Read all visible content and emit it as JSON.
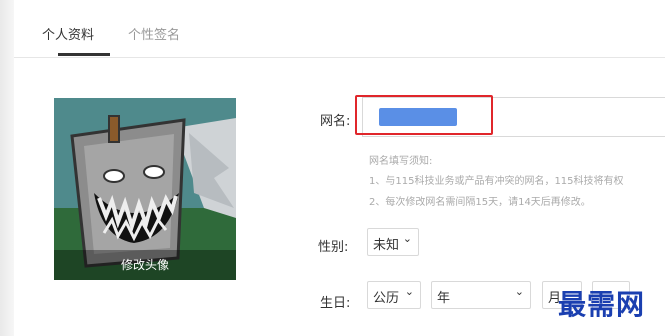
{
  "tabs": [
    {
      "label": "个人资料",
      "active": true
    },
    {
      "label": "个性签名",
      "active": false
    }
  ],
  "avatar": {
    "caption": "修改头像"
  },
  "form": {
    "nickname_label": "网名:",
    "nickname_value": "",
    "notice": [
      "网名填写须知:",
      "1、与115科技业务或产品有冲突的网名，115科技将有权",
      "2、每次修改网名需间隔15天，请14天后再修改。"
    ],
    "gender_label": "性别:",
    "gender_value": "未知",
    "birthday_label": "生日:",
    "calendar_value": "公历",
    "year_value": "年",
    "month_value": "月"
  },
  "colors": {
    "highlight": "#e0262b",
    "watermark": "#1a3fb0"
  },
  "watermark": "最需网",
  "icons": {
    "dropdown": "chevron-down-icon"
  }
}
